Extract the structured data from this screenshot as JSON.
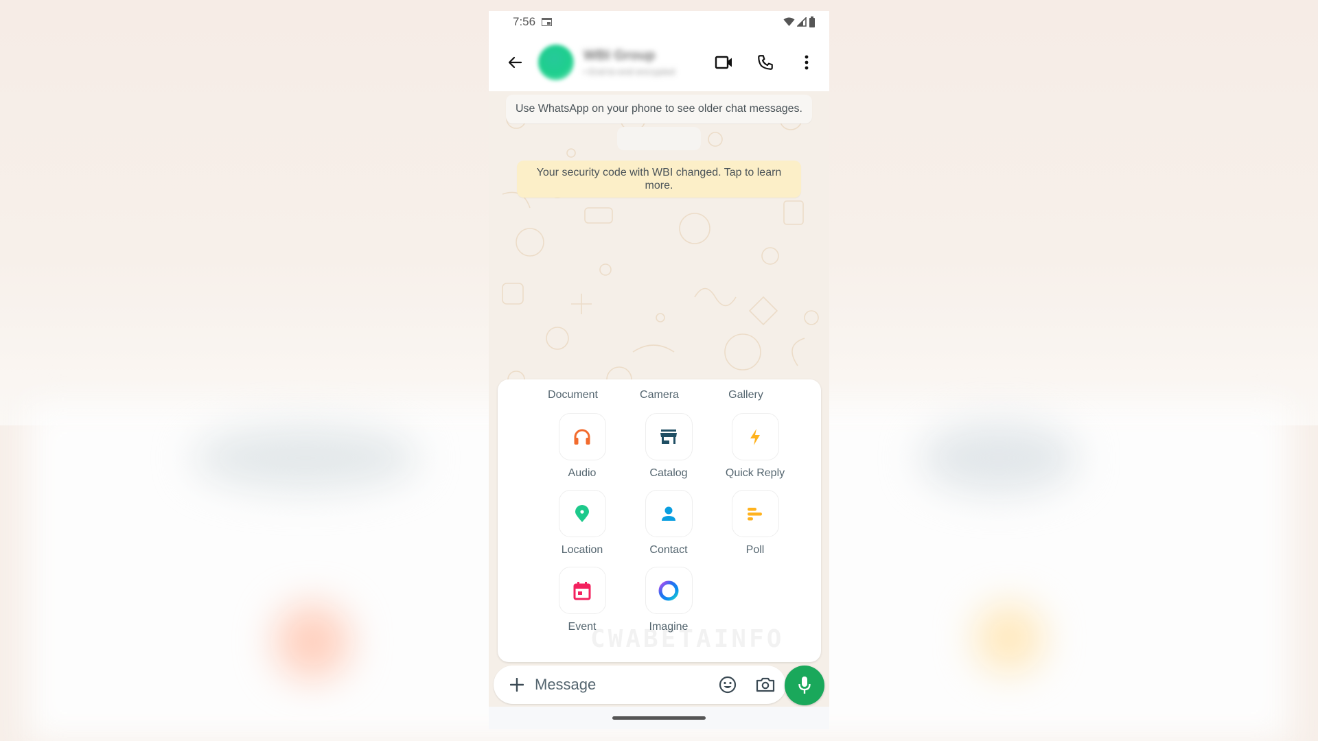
{
  "status_bar": {
    "time": "7:56",
    "icons": [
      "calendar-icon",
      "wifi-icon",
      "signal-icon",
      "battery-icon"
    ]
  },
  "header": {
    "title": "WBI Group",
    "subtitle": "• End-to-end encrypted",
    "icons": {
      "back": "arrow-left-icon",
      "video": "video-call-icon",
      "call": "phone-icon",
      "menu": "more-vertical-icon"
    },
    "avatar_color": "#1ecf8d"
  },
  "chat": {
    "older_messages_notice": "Use WhatsApp on your phone to see older chat messages.",
    "security_notice": "Your security code with WBI changed. Tap to learn more.",
    "security_bg": "#fcefc8"
  },
  "attachment_panel": {
    "top_row": [
      {
        "label": "Document"
      },
      {
        "label": "Camera"
      },
      {
        "label": "Gallery"
      }
    ],
    "items": [
      {
        "label": "Audio",
        "icon": "headphones-icon",
        "color": "#f26b2d"
      },
      {
        "label": "Catalog",
        "icon": "storefront-icon",
        "color": "#1f4e63"
      },
      {
        "label": "Quick Reply",
        "icon": "lightning-bolt-icon",
        "color": "#ffb21d"
      },
      {
        "label": "Location",
        "icon": "map-pin-icon",
        "color": "#1dc98b"
      },
      {
        "label": "Contact",
        "icon": "person-icon",
        "color": "#0a9ee0"
      },
      {
        "label": "Poll",
        "icon": "poll-icon",
        "color": "#ffb21d"
      },
      {
        "label": "Event",
        "icon": "calendar-event-icon",
        "color": "#f3215e"
      },
      {
        "label": "Imagine",
        "icon": "meta-ai-ring-icon",
        "color": "#2b6cf0"
      }
    ],
    "watermark": "CWABETAINFO"
  },
  "composer": {
    "placeholder": "Message",
    "value": "",
    "icons": {
      "attach": "plus-icon",
      "emoji": "emoji-icon",
      "camera": "camera-icon",
      "mic": "microphone-icon"
    },
    "mic_color": "#1aa85b"
  }
}
